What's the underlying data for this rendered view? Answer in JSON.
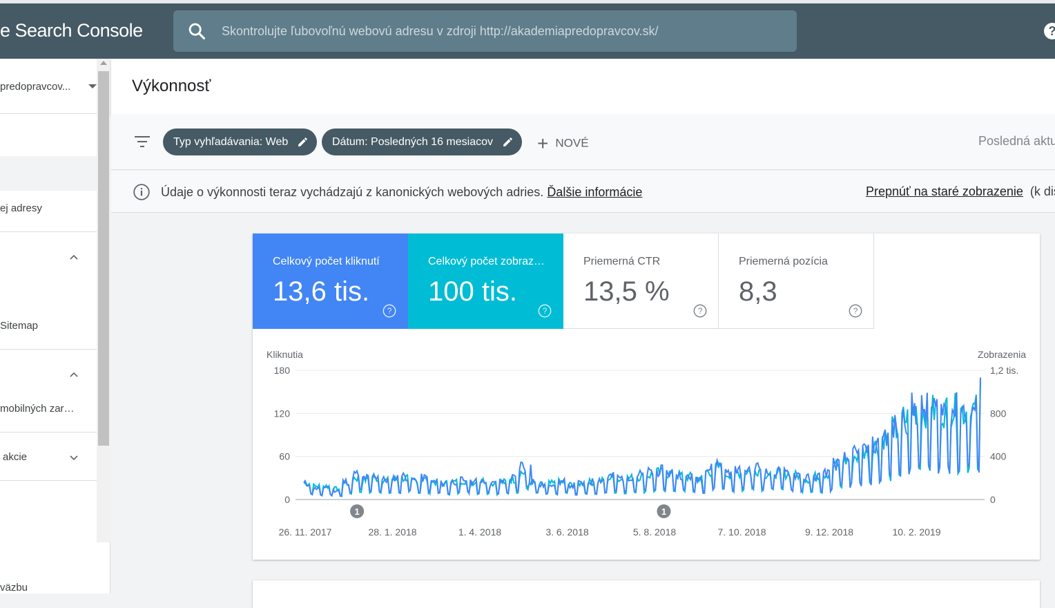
{
  "app": {
    "brand": "e Search Console"
  },
  "search": {
    "placeholder": "Skontrolujte ľubovoľnú webovú adresu v zdroji http://akademiapredopravcov.sk/"
  },
  "sidebar": {
    "property": "predopravcov...",
    "items": [
      {
        "label": "ej adresy"
      },
      {
        "label": "Sitemap"
      },
      {
        "label": "mobilných zar…"
      },
      {
        "label": "akcie"
      },
      {
        "label": "väzbu"
      }
    ]
  },
  "header": {
    "title": "Výkonnosť"
  },
  "filters": {
    "chips": [
      {
        "label": "Typ vyhľadávania: Web"
      },
      {
        "label": "Dátum: Posledných 16 mesiacov"
      }
    ],
    "new_label": "NOVÉ",
    "last_update": "Posledná aktu"
  },
  "info": {
    "message": "Údaje o výkonnosti teraz vychádzajú z kanonických webových adries.",
    "link": "Ďalšie informácie",
    "switch_link": "Prepnúť na staré zobrazenie",
    "switch_note": "(k disp"
  },
  "metrics": [
    {
      "label": "Celkový počet kliknutí",
      "value": "13,6 tis."
    },
    {
      "label": "Celkový počet zobraz…",
      "value": "100 tis."
    },
    {
      "label": "Priemerná CTR",
      "value": "13,5 %"
    },
    {
      "label": "Priemerná pozícia",
      "value": "8,3"
    }
  ],
  "colors": {
    "clicks": "#4285f4",
    "impressions": "#00bcd4",
    "topbar": "#455a64"
  },
  "chart_data": {
    "type": "line",
    "ylabel_left": "Kliknutia",
    "ylabel_right": "Zobrazenia",
    "ylim_left": [
      0,
      180
    ],
    "ylim_right": [
      0,
      1200
    ],
    "yticks_left": [
      "180",
      "120",
      "60",
      "0"
    ],
    "yticks_right": [
      "1,2 tis.",
      "800",
      "400",
      "0"
    ],
    "xticks": [
      "26. 11. 2017",
      "28. 1. 2018",
      "1. 4. 2018",
      "3. 6. 2018",
      "5. 8. 2018",
      "7. 10. 2018",
      "9. 12. 2018",
      "10. 2. 2019"
    ],
    "annotations": [
      {
        "date": "2018-01-03",
        "label": "1"
      },
      {
        "date": "2018-08-10",
        "label": "1"
      }
    ],
    "grid": true,
    "series": [
      {
        "name": "Kliknutia",
        "axis": "left",
        "weekly_avg": [
          18,
          12,
          14,
          10,
          20,
          28,
          24,
          26,
          22,
          24,
          26,
          22,
          24,
          20,
          18,
          20,
          22,
          20,
          22,
          18,
          20,
          24,
          38,
          20,
          16,
          18,
          20,
          16,
          18,
          20,
          22,
          26,
          24,
          26,
          28,
          30,
          32,
          30,
          28,
          26,
          24,
          34,
          40,
          30,
          32,
          34,
          36,
          30,
          32,
          30,
          28,
          24,
          26,
          30,
          40,
          45,
          50,
          55,
          60,
          72,
          80,
          90,
          100
        ]
      },
      {
        "name": "Zobrazenia",
        "axis": "right",
        "weekly_avg": [
          120,
          100,
          100,
          80,
          120,
          160,
          150,
          160,
          140,
          150,
          160,
          140,
          150,
          130,
          120,
          130,
          140,
          130,
          140,
          120,
          130,
          150,
          200,
          130,
          110,
          120,
          130,
          110,
          120,
          130,
          140,
          160,
          150,
          160,
          170,
          180,
          200,
          190,
          180,
          170,
          160,
          210,
          240,
          190,
          200,
          210,
          220,
          190,
          200,
          190,
          180,
          150,
          170,
          190,
          250,
          290,
          320,
          360,
          400,
          460,
          520,
          600,
          660
        ]
      }
    ]
  }
}
